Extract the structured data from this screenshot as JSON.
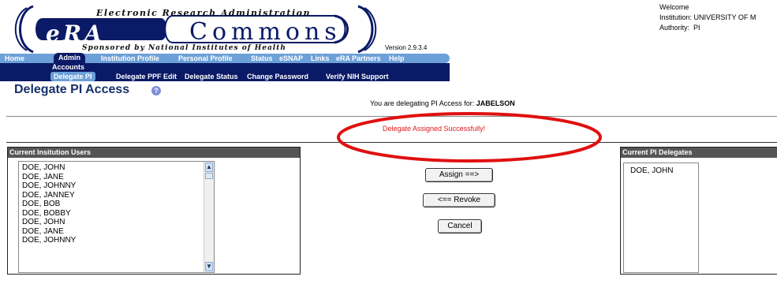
{
  "header": {
    "logo_top_text": "Electronic Research Administration",
    "logo_era": "eRA",
    "logo_commons": "Commons",
    "logo_bottom_text": "Sponsored by National Institutes of Health",
    "version": "Version 2.9.3.4",
    "welcome_label": "Welcome",
    "welcome_value": "",
    "institution_label": "Institution:",
    "institution_value": "UNIVERSITY OF M",
    "authority_label": "Authority:",
    "authority_value": "PI"
  },
  "nav": {
    "main": [
      "Home",
      "Admin",
      "Institution Profile",
      "Personal Profile",
      "Status",
      "eSNAP",
      "Links",
      "eRA Partners",
      "Help"
    ],
    "active_main": "Admin",
    "sub1": "Accounts",
    "sub2": [
      "Delegate PI",
      "Delegate PPF Edit",
      "Delegate Status",
      "Change Password",
      "Verify NIH Support"
    ],
    "active_sub2": "Delegate PI"
  },
  "page": {
    "title": "Delegate PI Access",
    "help_icon": "?",
    "delegating_prefix": "You are delegating PI Access for:",
    "delegating_user": "JABELSON",
    "success_message": "Delegate Assigned Successfully!"
  },
  "left_panel": {
    "header": "Current Insitution Users",
    "users": [
      "DOE, JOHN",
      "DOE, JANE",
      "DOE, JOHNNY",
      "DOE, JANNEY",
      "DOE, BOB",
      "DOE, BOBBY",
      "DOE, JOHN",
      "DOE, JANE",
      "DOE, JOHNNY"
    ]
  },
  "right_panel": {
    "header": "Current PI Delegates",
    "delegates": [
      "DOE, JOHN"
    ]
  },
  "buttons": {
    "assign": "Assign ==>",
    "revoke": "<== Revoke",
    "cancel": "Cancel"
  },
  "colors": {
    "nav_light": "#6ca0d8",
    "nav_dark": "#0a1a66",
    "success_text": "#e01818",
    "annotation_ellipse": "#e01010",
    "title_text": "#17306b"
  }
}
